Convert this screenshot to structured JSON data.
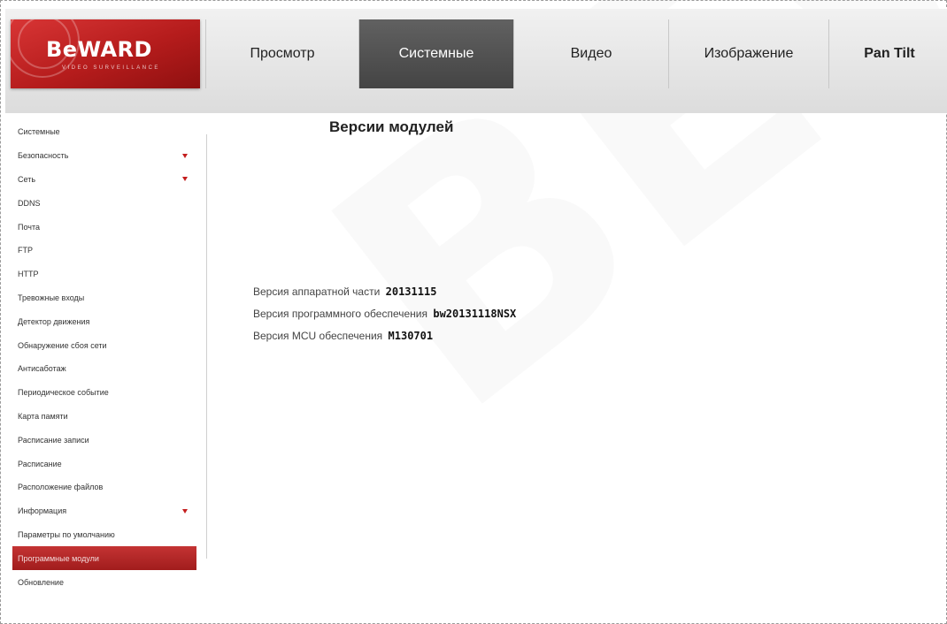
{
  "brand": {
    "logo_text": "BeWARD",
    "logo_sub": "video surveillance",
    "color": "#b81f1f"
  },
  "nav": {
    "tabs": [
      {
        "label": "Просмотр",
        "active": false
      },
      {
        "label": "Системные",
        "active": true
      },
      {
        "label": "Видео",
        "active": false
      },
      {
        "label": "Изображение",
        "active": false
      },
      {
        "label": "Pan Tilt",
        "active": false
      }
    ]
  },
  "sidebar": {
    "items": [
      {
        "label": "Системные",
        "expandable": false,
        "selected": false
      },
      {
        "label": "Безопасность",
        "expandable": true,
        "selected": false
      },
      {
        "label": "Сеть",
        "expandable": true,
        "selected": false
      },
      {
        "label": "DDNS",
        "expandable": false,
        "selected": false
      },
      {
        "label": "Почта",
        "expandable": false,
        "selected": false
      },
      {
        "label": "FTP",
        "expandable": false,
        "selected": false
      },
      {
        "label": "HTTP",
        "expandable": false,
        "selected": false
      },
      {
        "label": "Тревожные входы",
        "expandable": false,
        "selected": false
      },
      {
        "label": "Детектор движения",
        "expandable": false,
        "selected": false
      },
      {
        "label": "Обнаружение сбоя сети",
        "expandable": false,
        "selected": false
      },
      {
        "label": "Антисаботаж",
        "expandable": false,
        "selected": false
      },
      {
        "label": "Периодическое событие",
        "expandable": false,
        "selected": false
      },
      {
        "label": "Карта памяти",
        "expandable": false,
        "selected": false
      },
      {
        "label": "Расписание записи",
        "expandable": false,
        "selected": false
      },
      {
        "label": "Расписание",
        "expandable": false,
        "selected": false
      },
      {
        "label": "Расположение файлов",
        "expandable": false,
        "selected": false
      },
      {
        "label": "Информация",
        "expandable": true,
        "selected": false
      },
      {
        "label": "Параметры по умолчанию",
        "expandable": false,
        "selected": false
      },
      {
        "label": "Программные модули",
        "expandable": false,
        "selected": true
      },
      {
        "label": "Обновление",
        "expandable": false,
        "selected": false
      }
    ]
  },
  "main": {
    "title": "Версии модулей",
    "info": [
      {
        "label": "Версия аппаратной части",
        "value": "20131115"
      },
      {
        "label": "Версия программного обеспечения",
        "value": "bw20131118NSX"
      },
      {
        "label": "Версия MCU обеспечения",
        "value": "M130701"
      }
    ]
  },
  "watermark": "BEWARD"
}
